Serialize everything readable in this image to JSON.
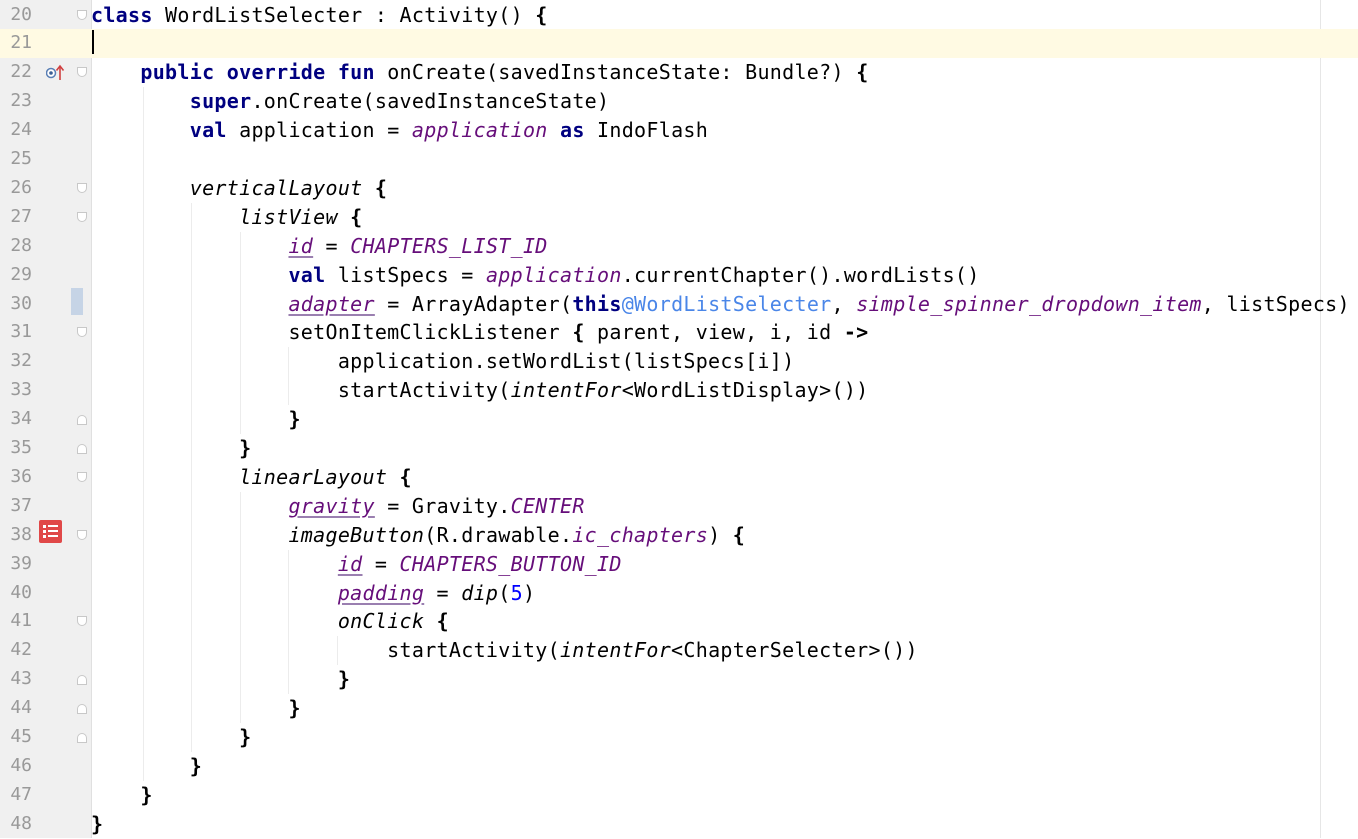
{
  "editor": {
    "language": "Kotlin",
    "caret_line": 21,
    "colors": {
      "keyword": "#000080",
      "property": "#660e7a",
      "number": "#0000ff",
      "annotation_label": "#4a86e8",
      "gutter_background": "#f0f0f0",
      "current_line": "#fffae3",
      "line_number": "#999999"
    },
    "gutter_icons": [
      {
        "line": 22,
        "icon": "override-method-icon"
      },
      {
        "line": 30,
        "icon": "vcs-change-marker"
      },
      {
        "line": 38,
        "icon": "resource-preview-icon"
      }
    ],
    "lines": [
      {
        "num": "20",
        "text": "class WordListSelecter : Activity() {"
      },
      {
        "num": "21",
        "text": ""
      },
      {
        "num": "22",
        "text": "    public override fun onCreate(savedInstanceState: Bundle?) {"
      },
      {
        "num": "23",
        "text": "        super.onCreate(savedInstanceState)"
      },
      {
        "num": "24",
        "text": "        val application = application as IndoFlash"
      },
      {
        "num": "25",
        "text": ""
      },
      {
        "num": "26",
        "text": "        verticalLayout {"
      },
      {
        "num": "27",
        "text": "            listView {"
      },
      {
        "num": "28",
        "text": "                id = CHAPTERS_LIST_ID"
      },
      {
        "num": "29",
        "text": "                val listSpecs = application.currentChapter().wordLists()"
      },
      {
        "num": "30",
        "text": "                adapter = ArrayAdapter(this@WordListSelecter, simple_spinner_dropdown_item, listSpecs)"
      },
      {
        "num": "31",
        "text": "                setOnItemClickListener { parent, view, i, id ->"
      },
      {
        "num": "32",
        "text": "                    application.setWordList(listSpecs[i])"
      },
      {
        "num": "33",
        "text": "                    startActivity(intentFor<WordListDisplay>())"
      },
      {
        "num": "34",
        "text": "                }"
      },
      {
        "num": "35",
        "text": "            }"
      },
      {
        "num": "36",
        "text": "            linearLayout {"
      },
      {
        "num": "37",
        "text": "                gravity = Gravity.CENTER"
      },
      {
        "num": "38",
        "text": "                imageButton(R.drawable.ic_chapters) {"
      },
      {
        "num": "39",
        "text": "                    id = CHAPTERS_BUTTON_ID"
      },
      {
        "num": "40",
        "text": "                    padding = dip(5)"
      },
      {
        "num": "41",
        "text": "                    onClick {"
      },
      {
        "num": "42",
        "text": "                        startActivity(intentFor<ChapterSelecter>())"
      },
      {
        "num": "43",
        "text": "                    }"
      },
      {
        "num": "44",
        "text": "                }"
      },
      {
        "num": "45",
        "text": "            }"
      },
      {
        "num": "46",
        "text": "        }"
      },
      {
        "num": "47",
        "text": "    }"
      },
      {
        "num": "48",
        "text": "}"
      }
    ]
  }
}
